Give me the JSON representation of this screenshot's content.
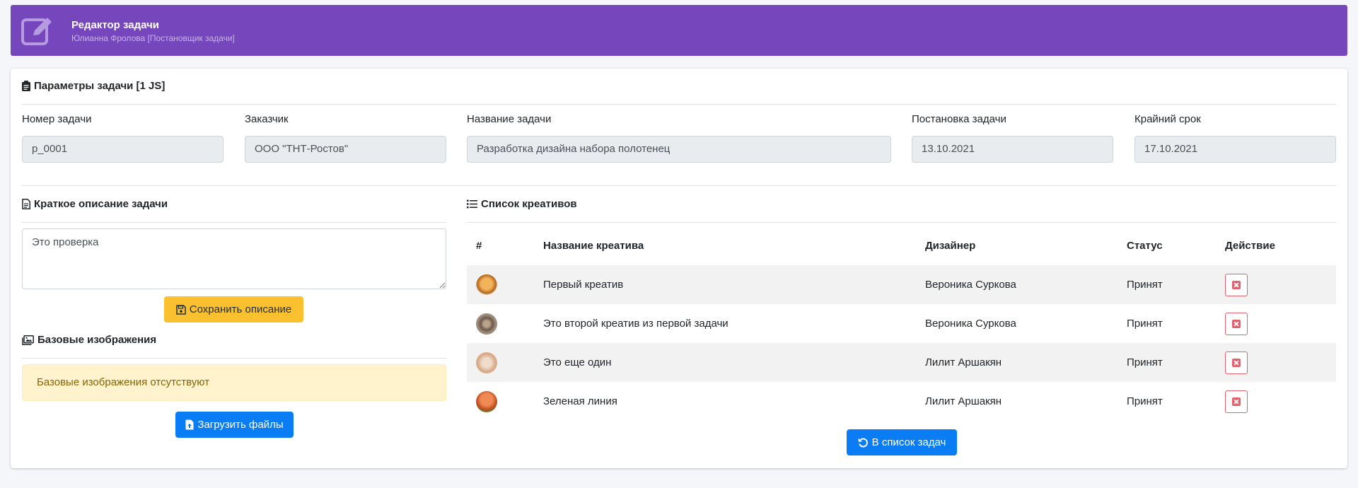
{
  "header": {
    "title": "Редактор задачи",
    "subtitle": "Юлианна Фролова [Постановщик задачи]",
    "accent": "#7646bd"
  },
  "params": {
    "title": "Параметры задачи [1 JS]",
    "fields": [
      {
        "label": "Номер задачи",
        "value": "p_0001"
      },
      {
        "label": "Заказчик",
        "value": "ООО \"ТНТ-Ростов\""
      },
      {
        "label": "Название задачи",
        "value": "Разработка дизайна набора полотенец"
      },
      {
        "label": "Постановка задачи",
        "value": "13.10.2021"
      },
      {
        "label": "Крайний срок",
        "value": "17.10.2021"
      }
    ]
  },
  "description": {
    "title": "Краткое описание задачи",
    "value": "Это проверка",
    "save_label": "Сохранить описание"
  },
  "base_images": {
    "title": "Базовые изображения",
    "empty_message": "Базовые изображения отсутствуют",
    "upload_label": "Загрузить файлы"
  },
  "creatives": {
    "title": "Список креативов",
    "columns": [
      "#",
      "Название креатива",
      "Дизайнер",
      "Статус",
      "Действие"
    ],
    "rows": [
      {
        "name": "Первый креатив",
        "designer": "Вероника Суркова",
        "status": "Принят",
        "thumb_color": "#c8872b"
      },
      {
        "name": "Это второй креатив из первой задачи",
        "designer": "Вероника Суркова",
        "status": "Принят",
        "thumb_color": "#8a7462"
      },
      {
        "name": "Это еще один",
        "designer": "Лилит Аршакян",
        "status": "Принят",
        "thumb_color": "#e3c0a3"
      },
      {
        "name": "Зеленая линия",
        "designer": "Лилит Аршакян",
        "status": "Принят",
        "thumb_color": "#d9663a"
      }
    ],
    "back_label": "В список задач"
  }
}
